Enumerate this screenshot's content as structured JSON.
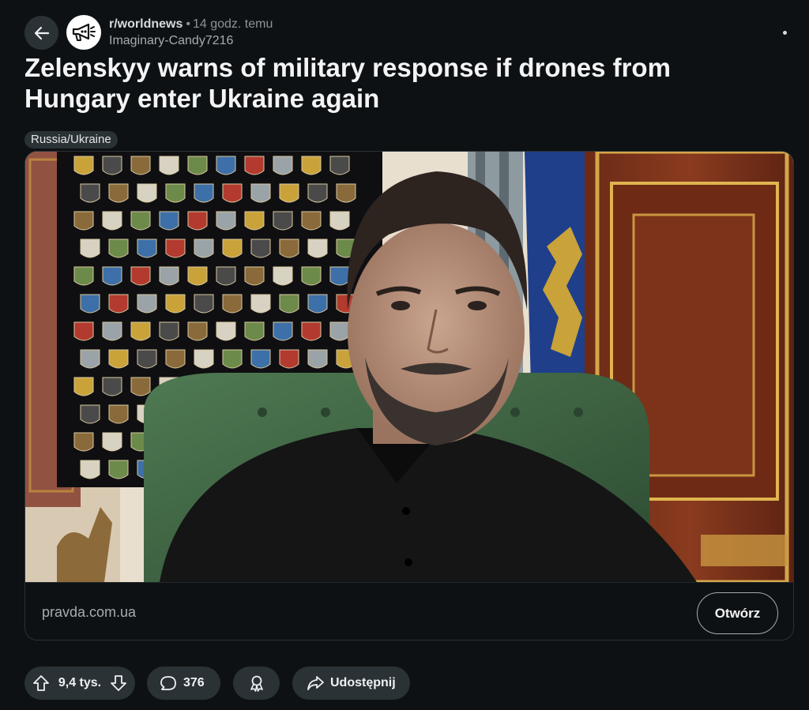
{
  "post": {
    "subreddit": "r/worldnews",
    "separator": "•",
    "time": "14 godz. temu",
    "author": "Imaginary-Candy7216",
    "title": "Zelenskyy warns of military response if drones from Hungary enter Ukraine again",
    "flair": "Russia/Ukraine"
  },
  "link": {
    "domain": "pravda.com.ua",
    "open_label": "Otwórz"
  },
  "actions": {
    "vote_count": "9,4 tys.",
    "comment_count": "376",
    "share_label": "Udostępnij"
  },
  "icons": {
    "back": "arrow-left-icon",
    "subreddit": "megaphone-icon",
    "more": "more-horizontal-icon",
    "upvote": "arrow-up-icon",
    "downvote": "arrow-down-icon",
    "comment": "speech-bubble-icon",
    "award": "award-icon",
    "share": "share-arrow-icon"
  },
  "colors": {
    "background": "#0e1113",
    "pill": "#2a3236",
    "text": "#eef1f3",
    "muted": "#8b9398"
  }
}
